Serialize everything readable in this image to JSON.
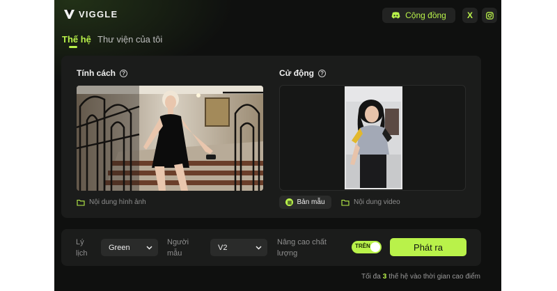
{
  "brand": {
    "name": "VIGGLE"
  },
  "header": {
    "community_label": "Cộng đồng",
    "x_label": "X",
    "instagram_icon": "instagram-icon",
    "discord_icon": "discord-icon"
  },
  "tabs": [
    {
      "label": "Thế hệ",
      "active": true
    },
    {
      "label": "Thư viện của tôi",
      "active": false
    }
  ],
  "character": {
    "title": "Tính cách",
    "help": "?",
    "upload_link": "Nội dung hình ảnh"
  },
  "motion": {
    "title": "Cử động",
    "help": "?",
    "sample_button": "Bản mẫu",
    "upload_link": "Nội dung video"
  },
  "settings": {
    "background_label": "Lý lịch",
    "background_value": "Green",
    "model_label": "Người mẫu",
    "model_value": "V2",
    "quality_label": "Nâng cao chất lượng",
    "quality_toggle_text": "TRÊN",
    "quality_enabled": true,
    "generate_label": "Phát ra"
  },
  "footnote": {
    "prefix": "Tối đa",
    "count": "3",
    "suffix": "thế hệ vào thời gian cao điểm"
  },
  "colors": {
    "accent": "#b9f24a",
    "background": "#0f100f",
    "panel": "#1b1c1b"
  }
}
